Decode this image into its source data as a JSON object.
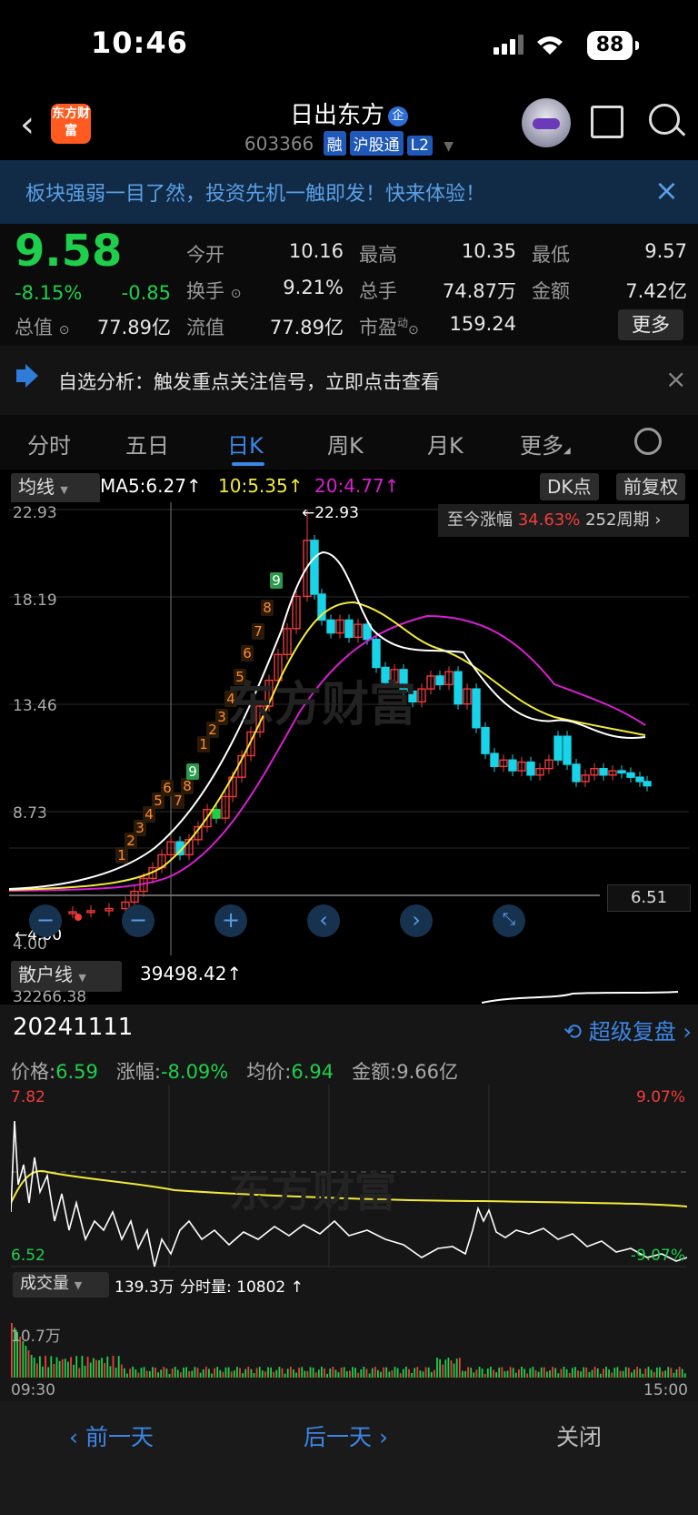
{
  "status": {
    "time": "10:46",
    "battery": "88"
  },
  "header": {
    "logo_text": "东方财富",
    "stock_name": "日出东方",
    "badge": "企",
    "code": "603366",
    "tags": [
      "融",
      "沪股通",
      "L2"
    ]
  },
  "banner": {
    "text": "板块强弱一目了然，投资先机一触即发！快来体验！"
  },
  "quote": {
    "price": "9.58",
    "change_pct": "-8.15%",
    "change": "-0.85",
    "stats": [
      {
        "label": "今开",
        "value": "10.16"
      },
      {
        "label": "最高",
        "value": "10.35"
      },
      {
        "label": "最低",
        "value": "9.57"
      },
      {
        "label": "换手",
        "value": "9.21%"
      },
      {
        "label": "总手",
        "value": "74.87万"
      },
      {
        "label": "金额",
        "value": "7.42亿"
      },
      {
        "label": "总值",
        "value": "77.89亿"
      },
      {
        "label": "流值",
        "value": "77.89亿"
      },
      {
        "label": "市盈",
        "sup": "动",
        "value": "159.24"
      }
    ],
    "more": "更多"
  },
  "notice": {
    "text": "自选分析：触发重点关注信号，立即点击查看"
  },
  "tabs": [
    {
      "label": "分时"
    },
    {
      "label": "五日"
    },
    {
      "label": "日K"
    },
    {
      "label": "周K"
    },
    {
      "label": "月K"
    },
    {
      "label": "更多"
    }
  ],
  "ma": {
    "selector": "均线",
    "ma5": "MA5:6.27↑",
    "ma10": "10:5.35↑",
    "ma20": "20:4.77↑",
    "dk": "DK点",
    "adjust": "前复权"
  },
  "colors": {
    "up": "#f23b3b",
    "down": "#1fcf4c",
    "cyan": "#18d4e8",
    "ma5": "#ffffff",
    "ma10": "#f2ea3a",
    "ma20": "#d81fd2",
    "accent": "#3c86e6"
  },
  "kchart": {
    "y_labels": [
      "22.93",
      "18.19",
      "13.46",
      "8.73",
      "4.00"
    ],
    "high_label": "←22.93",
    "low_label": "←4.00",
    "current_line": "6.51",
    "gain_label": "至今涨幅",
    "gain_value": "34.63%",
    "period": "252周期",
    "watermark": "东方财富",
    "td_labels": [
      "1",
      "2",
      "3",
      "4",
      "5",
      "6",
      "7",
      "8",
      "9",
      "1",
      "2",
      "3",
      "4",
      "5",
      "6",
      "7",
      "8",
      "9"
    ]
  },
  "retail": {
    "selector": "散户线",
    "value": "39498.42↑",
    "axis": "32266.38"
  },
  "intraday": {
    "date": "20241111",
    "replay": "超级复盘",
    "price_label": "价格:",
    "price": "6.59",
    "chg_label": "涨幅:",
    "chg": "-8.09%",
    "avg_label": "均价:",
    "avg": "6.94",
    "amt_label": "金额:",
    "amt": "9.66亿",
    "top_left": "7.82",
    "top_right": "9.07%",
    "bottom_left": "6.52",
    "bottom_right": "-9.07%",
    "vol_selector": "成交量",
    "vol_value": "139.3万",
    "vol_min": "分时量: 10802 ↑",
    "vol_max": "10.7万",
    "time_start": "09:30",
    "time_end": "15:00"
  },
  "bottom": {
    "prev": "‹ 前一天",
    "next": "后一天 ›",
    "close": "关闭"
  }
}
